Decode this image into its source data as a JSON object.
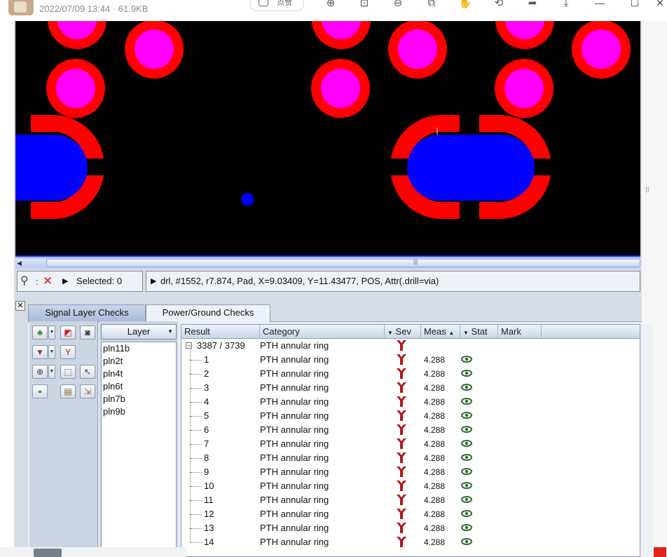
{
  "viewer": {
    "file_meta": "2022/07/09 13:44 · 61.9KB",
    "like_label": "点赞"
  },
  "status": {
    "selected_label": "Selected: 0",
    "info_text": "drl, #1552, r7.874, Pad, X=9.03409, Y=11.43477, POS, Attr(.drill=via)"
  },
  "tabs": [
    {
      "label": "Signal Layer Checks",
      "active": false
    },
    {
      "label": "Power/Ground Checks",
      "active": true
    }
  ],
  "layer_panel": {
    "header": "Layer",
    "items": [
      "pln11b",
      "pln2t",
      "pln4t",
      "pln6t",
      "pln7b",
      "pln9b"
    ]
  },
  "results": {
    "columns": {
      "result": "Result",
      "category": "Category",
      "sev": "Sev",
      "meas": "Meas",
      "stat": "Stat",
      "mark": "Mark"
    },
    "root": {
      "result": "3387 / 3739",
      "category": "PTH annular ring"
    },
    "rows": [
      {
        "result": "1",
        "category": "PTH annular ring",
        "meas": "4.288"
      },
      {
        "result": "2",
        "category": "PTH annular ring",
        "meas": "4.288"
      },
      {
        "result": "3",
        "category": "PTH annular ring",
        "meas": "4.288"
      },
      {
        "result": "4",
        "category": "PTH annular ring",
        "meas": "4.288"
      },
      {
        "result": "5",
        "category": "PTH annular ring",
        "meas": "4.288"
      },
      {
        "result": "6",
        "category": "PTH annular ring",
        "meas": "4.288"
      },
      {
        "result": "7",
        "category": "PTH annular ring",
        "meas": "4.288"
      },
      {
        "result": "8",
        "category": "PTH annular ring",
        "meas": "4.288"
      },
      {
        "result": "9",
        "category": "PTH annular ring",
        "meas": "4.288"
      },
      {
        "result": "10",
        "category": "PTH annular ring",
        "meas": "4.288"
      },
      {
        "result": "11",
        "category": "PTH annular ring",
        "meas": "4.288"
      },
      {
        "result": "12",
        "category": "PTH annular ring",
        "meas": "4.288"
      },
      {
        "result": "13",
        "category": "PTH annular ring",
        "meas": "4.288"
      },
      {
        "result": "14",
        "category": "PTH annular ring",
        "meas": "4.288"
      }
    ]
  },
  "colors": {
    "pad_ring": "#ff0000",
    "pad_center": "#ff00ff",
    "oval_pad": "#0000ff",
    "canvas_bg": "#000000",
    "severity_icon": "#b01818",
    "stat_icon": "#2f6b2f"
  },
  "icons": {
    "filter": "filter-icon",
    "clear": "close-x-icon",
    "severity": "severity-marker-icon",
    "status": "eye-icon"
  }
}
